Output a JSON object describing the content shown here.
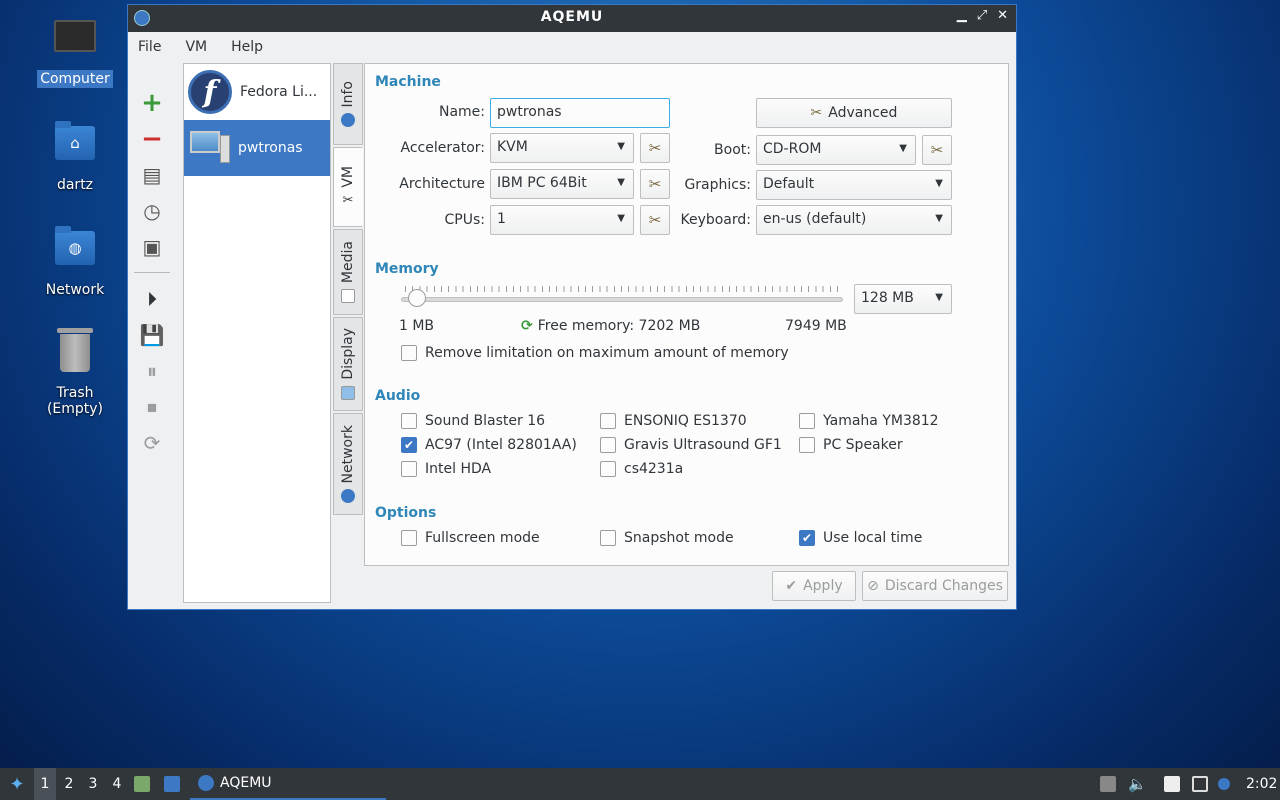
{
  "desktop": {
    "icons": [
      {
        "label": "Computer"
      },
      {
        "label": "dartz"
      },
      {
        "label": "Network"
      },
      {
        "label": "Trash (Empty)"
      }
    ]
  },
  "window": {
    "title": "AQEMU",
    "menu": [
      "File",
      "VM",
      "Help"
    ],
    "vm_list": [
      "Fedora Li...",
      "pwtronas"
    ],
    "tabs": [
      "Info",
      "VM",
      "Media",
      "Display",
      "Network"
    ],
    "sections": {
      "machine": "Machine",
      "memory": "Memory",
      "audio": "Audio",
      "options": "Options"
    },
    "machine": {
      "name_label": "Name:",
      "name_value": "pwtronas",
      "accelerator_label": "Accelerator:",
      "accelerator_value": "KVM",
      "architecture_label": "Architecture",
      "architecture_value": "IBM PC 64Bit",
      "cpus_label": "CPUs:",
      "cpus_value": "1",
      "advanced_label": "Advanced",
      "boot_label": "Boot:",
      "boot_value": "CD-ROM",
      "graphics_label": "Graphics:",
      "graphics_value": "Default",
      "keyboard_label": "Keyboard:",
      "keyboard_value": "en-us (default)"
    },
    "memory": {
      "value": "128 MB",
      "min_label": "1 MB",
      "free_label": "Free memory: 7202 MB",
      "max_label": "7949 MB",
      "slider_fraction": 0.016,
      "remove_limit_label": "Remove limitation on maximum amount of memory"
    },
    "audio": [
      {
        "label": "Sound Blaster 16",
        "checked": false
      },
      {
        "label": "AC97 (Intel 82801AA)",
        "checked": true
      },
      {
        "label": "Intel HDA",
        "checked": false
      },
      {
        "label": "ENSONIQ ES1370",
        "checked": false
      },
      {
        "label": "Gravis Ultrasound GF1",
        "checked": false
      },
      {
        "label": "cs4231a",
        "checked": false
      },
      {
        "label": "Yamaha YM3812",
        "checked": false
      },
      {
        "label": "PC Speaker",
        "checked": false
      }
    ],
    "options": [
      {
        "label": "Fullscreen mode",
        "checked": false
      },
      {
        "label": "Snapshot mode",
        "checked": false
      },
      {
        "label": "Use local time",
        "checked": true
      }
    ],
    "apply_label": "Apply",
    "discard_label": "Discard Changes"
  },
  "taskbar": {
    "workspaces": [
      "1",
      "2",
      "3",
      "4"
    ],
    "task_label": "AQEMU",
    "clock": "2:02"
  },
  "colors": {
    "accent": "#3d78c4",
    "section": "#2f86b8",
    "titlebar": "#31363b"
  }
}
